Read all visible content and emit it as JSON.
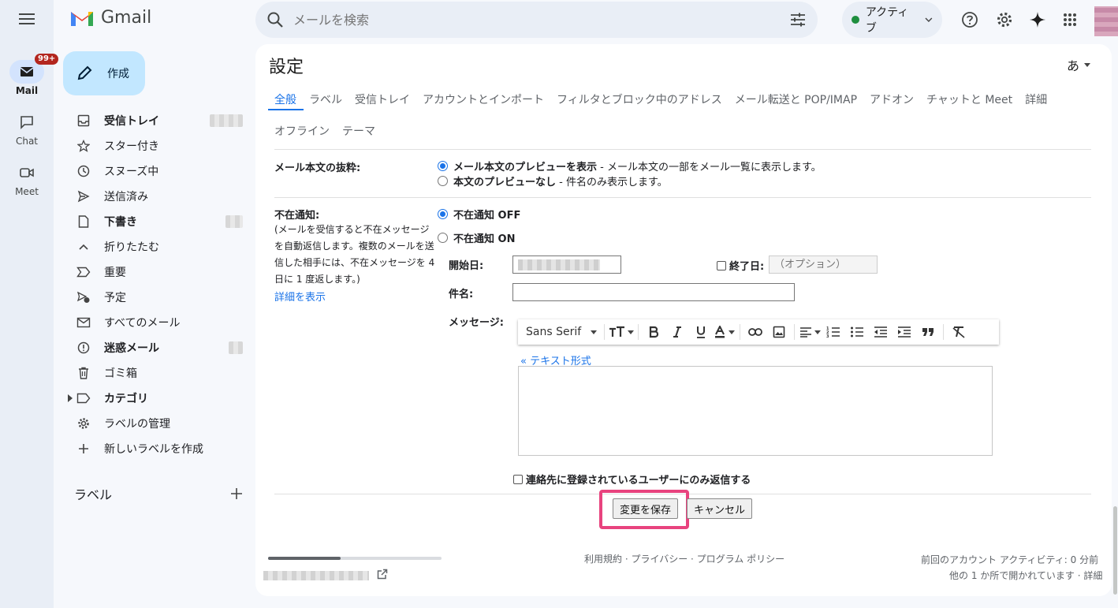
{
  "rail": {
    "items": [
      {
        "label": "Mail",
        "badge": "99+",
        "icon": "mail-icon"
      },
      {
        "label": "Chat",
        "icon": "chat-icon"
      },
      {
        "label": "Meet",
        "icon": "video-icon"
      }
    ]
  },
  "brand": {
    "name": "Gmail"
  },
  "compose": {
    "label": "作成"
  },
  "sidebar": {
    "items": [
      {
        "label": "受信トレイ",
        "icon": "inbox-icon"
      },
      {
        "label": "スター付き",
        "icon": "star-icon"
      },
      {
        "label": "スヌーズ中",
        "icon": "clock-icon"
      },
      {
        "label": "送信済み",
        "icon": "send-icon"
      },
      {
        "label": "下書き",
        "icon": "draft-icon"
      },
      {
        "label": "折りたたむ",
        "icon": "chevron-up-icon"
      },
      {
        "label": "重要",
        "icon": "important-icon"
      },
      {
        "label": "予定",
        "icon": "scheduled-icon"
      },
      {
        "label": "すべてのメール",
        "icon": "all-mail-icon"
      },
      {
        "label": "迷惑メール",
        "icon": "spam-icon"
      },
      {
        "label": "ゴミ箱",
        "icon": "trash-icon"
      },
      {
        "label": "カテゴリ",
        "icon": "label-icon"
      },
      {
        "label": "ラベルの管理",
        "icon": "gear-icon"
      },
      {
        "label": "新しいラベルを作成",
        "icon": "plus-icon"
      }
    ],
    "labels_heading": "ラベル"
  },
  "search": {
    "placeholder": "メールを検索"
  },
  "status": {
    "label": "アクティブ",
    "color": "#1e8e3e"
  },
  "settings": {
    "title": "設定",
    "lang_glyph": "あ",
    "tabs_row1": [
      "全般",
      "ラベル",
      "受信トレイ",
      "アカウントとインポート",
      "フィルタとブロック中のアドレス",
      "メール転送と POP/IMAP",
      "アドオン",
      "チャットと Meet",
      "詳細"
    ],
    "tabs_row2": [
      "オフライン",
      "テーマ"
    ]
  },
  "snippets": {
    "label": "メール本文の抜粋:",
    "opt1_bold": "メール本文のプレビューを表示",
    "opt1_rest": " - メール本文の一部をメール一覧に表示します。",
    "opt2_bold": "本文のプレビューなし",
    "opt2_rest": " - 件名のみ表示します。"
  },
  "vacation": {
    "label": "不在通知:",
    "desc": "(メールを受信すると不在メッセージを自動返信します。複数のメールを送信した相手には、不在メッセージを 4 日に 1 度返します。)",
    "learn_more": "詳細を表示",
    "off": "不在通知 OFF",
    "on": "不在通知 ON",
    "start_label": "開始日:",
    "end_label": "終了日:",
    "end_placeholder": "（オプション）",
    "subject_label": "件名:",
    "message_label": "メッセージ:",
    "font": "Sans Serif",
    "plain_text_link": "« テキスト形式",
    "contacts_only": "連絡先に登録されているユーザーにのみ返信する"
  },
  "buttons": {
    "save": "変更を保存",
    "cancel": "キャンセル"
  },
  "footer": {
    "links": "利用規約 · プライバシー · プログラム ポリシー",
    "activity": "前回のアカウント アクティビティ: 0 分前",
    "open_elsewhere": "他の 1 か所で開かれています · 詳細"
  }
}
